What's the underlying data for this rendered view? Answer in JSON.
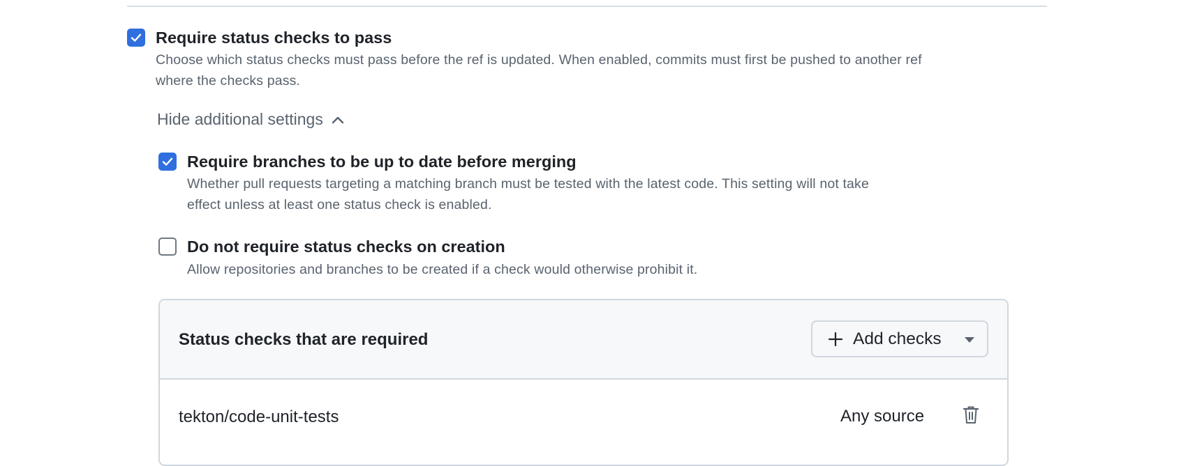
{
  "options": [
    {
      "label": "Require status checks to pass",
      "description_line1": "Choose which status checks must pass before the ref is updated. When enabled, commits must first be pushed to another ref",
      "description_line2": "where the checks pass.",
      "checked": true
    },
    {
      "label": "Require branches to be up to date before merging",
      "description_line1": "Whether pull requests targeting a matching branch must be tested with the latest code. This setting will not take",
      "description_line2": "effect unless at least one status check is enabled.",
      "checked": true
    },
    {
      "label": "Do not require status checks on creation",
      "description_line1": "Allow repositories and branches to be created if a check would otherwise prohibit it.",
      "checked": false
    }
  ],
  "toggle": {
    "label": "Hide additional settings",
    "icon": "chevron-up-icon"
  },
  "status_checks": {
    "title": "Status checks that are required",
    "add_button": {
      "label": "Add checks",
      "icons": [
        "plus-icon",
        "triangle-down-icon"
      ]
    },
    "rows": [
      {
        "name": "tekton/code-unit-tests",
        "source": "Any source",
        "action_icon": "trash-icon"
      }
    ]
  },
  "colors": {
    "accent": "#2f6fde",
    "text_primary": "#1f2328",
    "text_muted": "#59636e",
    "border": "#d0d7de",
    "header_bg": "#f6f8fa"
  }
}
